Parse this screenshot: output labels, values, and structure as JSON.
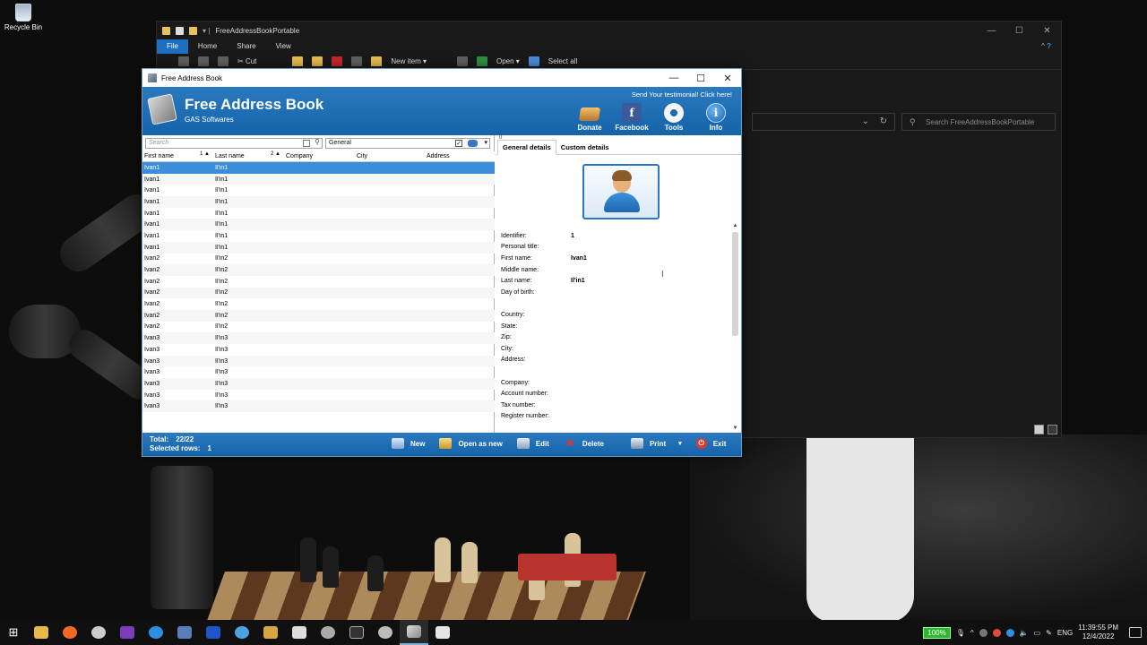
{
  "desktop": {
    "recycle_bin_label": "Recycle Bin"
  },
  "explorer": {
    "title": "FreeAddressBookPortable",
    "tabs": [
      "File",
      "Home",
      "Share",
      "View"
    ],
    "ribbon": {
      "cut": "Cut",
      "new_item": "New item ▾",
      "open": "Open ▾",
      "select_all": "Select all"
    },
    "search_placeholder": "Search FreeAddressBookPortable"
  },
  "fab": {
    "window_title": "Free Address Book",
    "app_name": "Free Address Book",
    "company": "GAS Softwares",
    "testimonial": "Send Your testimonial! Click here!",
    "header_buttons": [
      "Donate",
      "Facebook",
      "Tools",
      "Info"
    ],
    "search_placeholder": "Search",
    "group_value": "General",
    "columns": [
      "First name",
      "Last name",
      "Company",
      "City",
      "Address"
    ],
    "sort": {
      "first_index": "1",
      "last_index": "2"
    },
    "rows": [
      [
        "Ivan1",
        "Il'in1"
      ],
      [
        "Ivan1",
        "Il'in1"
      ],
      [
        "Ivan1",
        "Il'in1"
      ],
      [
        "Ivan1",
        "Il'in1"
      ],
      [
        "Ivan1",
        "Il'in1"
      ],
      [
        "Ivan1",
        "Il'in1"
      ],
      [
        "Ivan1",
        "Il'in1"
      ],
      [
        "Ivan1",
        "Il'in1"
      ],
      [
        "Ivan2",
        "Il'in2"
      ],
      [
        "Ivan2",
        "Il'in2"
      ],
      [
        "Ivan2",
        "Il'in2"
      ],
      [
        "Ivan2",
        "Il'in2"
      ],
      [
        "Ivan2",
        "Il'in2"
      ],
      [
        "Ivan2",
        "Il'in2"
      ],
      [
        "Ivan2",
        "Il'in2"
      ],
      [
        "Ivan3",
        "Il'in3"
      ],
      [
        "Ivan3",
        "Il'in3"
      ],
      [
        "Ivan3",
        "Il'in3"
      ],
      [
        "Ivan3",
        "Il'in3"
      ],
      [
        "Ivan3",
        "Il'in3"
      ],
      [
        "Ivan3",
        "Il'in3"
      ],
      [
        "Ivan3",
        "Il'in3"
      ]
    ],
    "selected_row": 0,
    "detail_tab_marker": "0",
    "detail_tabs": [
      "General details",
      "Custom details"
    ],
    "details": [
      {
        "label": "Identifier:",
        "value": "1"
      },
      {
        "label": "Personal title:",
        "value": ""
      },
      {
        "label": "First name:",
        "value": "Ivan1"
      },
      {
        "label": "Middle name:",
        "value": ""
      },
      {
        "label": "Last name:",
        "value": "Il'in1"
      },
      {
        "label": "Day of birth:",
        "value": ""
      },
      {
        "label": "",
        "value": ""
      },
      {
        "label": "Country:",
        "value": ""
      },
      {
        "label": "State:",
        "value": ""
      },
      {
        "label": "Zip:",
        "value": ""
      },
      {
        "label": "City:",
        "value": ""
      },
      {
        "label": "Address:",
        "value": ""
      },
      {
        "label": "",
        "value": ""
      },
      {
        "label": "Company:",
        "value": ""
      },
      {
        "label": "Account number:",
        "value": ""
      },
      {
        "label": "Tax number:",
        "value": ""
      },
      {
        "label": "Register number:",
        "value": ""
      }
    ],
    "footer": {
      "total_label": "Total:",
      "total_value": "22/22",
      "selected_label": "Selected rows:",
      "selected_value": "1",
      "buttons": [
        "New",
        "Open as new",
        "Edit",
        "Delete",
        "Print",
        "Exit"
      ]
    }
  },
  "taskbar": {
    "battery": "100%",
    "language": "ENG",
    "time": "11:39:55 PM",
    "date": "12/4/2022"
  }
}
